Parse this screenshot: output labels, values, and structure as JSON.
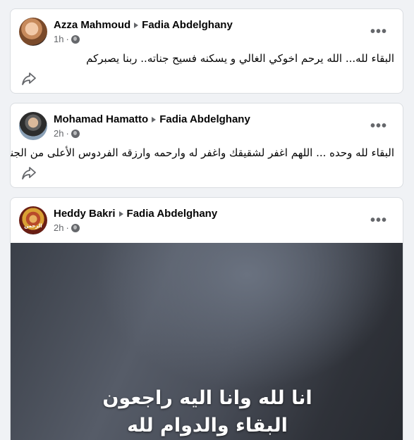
{
  "posts": [
    {
      "author": "Azza Mahmoud",
      "target": "Fadia Abdelghany",
      "time": "1h",
      "text": "البقاء لله... الله يرحم اخوكي الغالي و يسكنه فسيح جناته.. ربنا يصبركم"
    },
    {
      "author": "Mohamad Hamatto",
      "target": "Fadia Abdelghany",
      "time": "2h",
      "text": "البقاء لله وحده ... اللهم اغفر لشقيقك واغفر له وارحمه وارزقه الفردوس الأعلى من الجنة"
    },
    {
      "author": "Heddy Bakri",
      "target": "Fadia Abdelghany",
      "time": "2h",
      "avatar_text": "الرحمن",
      "media_caption_line1": "انا لله وانا اليه راجعون",
      "media_caption_line2": "البقاء والدوام لله"
    }
  ],
  "ui": {
    "dot": "·",
    "more": "•••"
  },
  "colors": {
    "background": "#f0f2f5",
    "card": "#ffffff",
    "secondary_text": "#65676b"
  },
  "icons": [
    "globe-icon",
    "share-icon",
    "more-options-icon",
    "arrow-right-icon"
  ]
}
